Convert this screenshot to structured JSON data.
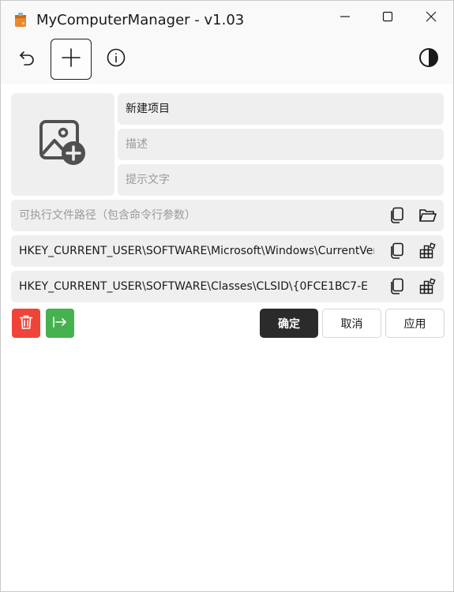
{
  "window": {
    "title": "MyComputerManager - v1.03",
    "controls": [
      "minimize-icon",
      "maximize-icon",
      "close-icon"
    ]
  },
  "toolbar": {
    "icons": [
      "undo-icon",
      "add-icon",
      "info-icon",
      "theme-toggle-icon"
    ]
  },
  "form": {
    "image_picker_icon": "add-image-icon",
    "name": {
      "value": "新建项目"
    },
    "description": {
      "placeholder": "描述"
    },
    "tip": {
      "placeholder": "提示文字"
    },
    "executable_path": {
      "placeholder": "可执行文件路径（包含命令行参数）",
      "icons": [
        "copy-icon",
        "folder-open-icon"
      ]
    },
    "registry_path_1": {
      "value": "HKEY_CURRENT_USER\\SOFTWARE\\Microsoft\\Windows\\CurrentVersion\\Explorer\\MyComputer\\NameSpace",
      "icons": [
        "copy-icon",
        "registry-icon"
      ]
    },
    "registry_path_2": {
      "value": "HKEY_CURRENT_USER\\SOFTWARE\\Classes\\CLSID\\{0FCE1BC7-E",
      "icons": [
        "copy-icon",
        "registry-icon"
      ]
    }
  },
  "actions": {
    "delete_icon": "trash-icon",
    "export_icon": "export-arrow-icon",
    "ok_label": "确定",
    "cancel_label": "取消",
    "apply_label": "应用"
  },
  "colors": {
    "delete": "#f04438",
    "export": "#46b14f",
    "primary": "#2b2b2b",
    "field_bg": "#efefef"
  }
}
